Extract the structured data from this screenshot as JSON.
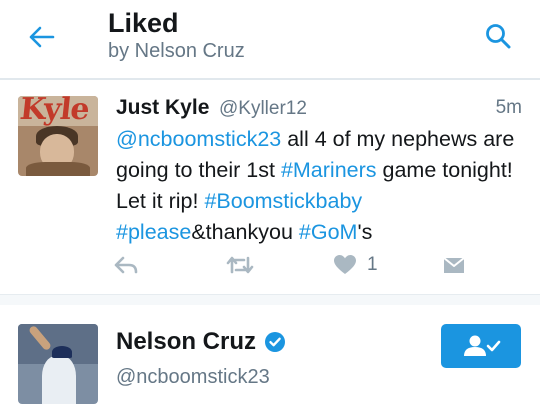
{
  "header": {
    "title": "Liked",
    "subtitle": "by Nelson Cruz"
  },
  "tweet": {
    "name": "Just Kyle",
    "handle": "@Kyller12",
    "time": "5m",
    "avatar_text": "Kyle",
    "body": [
      {
        "t": "@ncboomstick23",
        "link": true
      },
      {
        "t": " all 4 of my nephews are going to their 1st ",
        "link": false
      },
      {
        "t": "#Mariners",
        "link": true
      },
      {
        "t": " game tonight! Let it rip! ",
        "link": false
      },
      {
        "t": "#Boomstickbaby",
        "link": true
      },
      {
        "t": " ",
        "link": false
      },
      {
        "t": "#please",
        "link": true
      },
      {
        "t": "&thankyou ",
        "link": false
      },
      {
        "t": "#GoM",
        "link": true
      },
      {
        "t": "'s",
        "link": false
      }
    ],
    "like_count": "1"
  },
  "user": {
    "name": "Nelson Cruz",
    "handle": "@ncboomstick23"
  },
  "colors": {
    "accent": "#1b95e0",
    "secondary_text": "#657786",
    "icon_gray": "#aab8c2"
  },
  "icons": [
    "back-arrow-icon",
    "search-icon",
    "reply-icon",
    "retweet-icon",
    "heart-icon",
    "direct-message-icon",
    "verified-icon",
    "following-icon"
  ]
}
